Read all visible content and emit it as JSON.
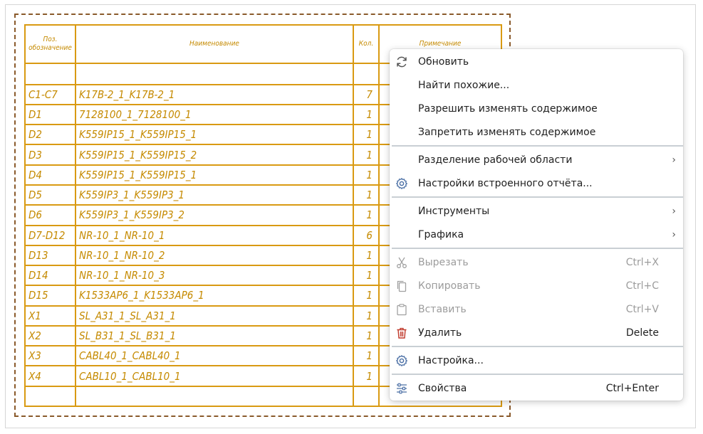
{
  "table": {
    "headers": {
      "pos_line1": "Поз.",
      "pos_line2": "обозначение",
      "name": "Наименование",
      "qty": "Кол.",
      "note": "Примечание"
    },
    "rows": [
      {
        "pos": "C1-C7",
        "name": "K17B-2_1_K17B-2_1",
        "qty": "7"
      },
      {
        "pos": "D1",
        "name": "7128100_1_7128100_1",
        "qty": "1"
      },
      {
        "pos": "D2",
        "name": "K559IP15_1_K559IP15_1",
        "qty": "1"
      },
      {
        "pos": "D3",
        "name": "K559IP15_1_K559IP15_2",
        "qty": "1"
      },
      {
        "pos": "D4",
        "name": "K559IP15_1_K559IP15_1",
        "qty": "1"
      },
      {
        "pos": "D5",
        "name": "K559IP3_1_K559IP3_1",
        "qty": "1"
      },
      {
        "pos": "D6",
        "name": "K559IP3_1_K559IP3_2",
        "qty": "1"
      },
      {
        "pos": "D7-D12",
        "name": "NR-10_1_NR-10_1",
        "qty": "6"
      },
      {
        "pos": "D13",
        "name": "NR-10_1_NR-10_2",
        "qty": "1"
      },
      {
        "pos": "D14",
        "name": "NR-10_1_NR-10_3",
        "qty": "1"
      },
      {
        "pos": "D15",
        "name": "K1533AP6_1_K1533AP6_1",
        "qty": "1"
      },
      {
        "pos": "X1",
        "name": "SL_A31_1_SL_A31_1",
        "qty": "1"
      },
      {
        "pos": "X2",
        "name": "SL_B31_1_SL_B31_1",
        "qty": "1"
      },
      {
        "pos": "X3",
        "name": "CABL40_1_CABL40_1",
        "qty": "1"
      },
      {
        "pos": "X4",
        "name": "CABL10_1_CABL10_1",
        "qty": "1"
      }
    ]
  },
  "menu": {
    "refresh": "Обновить",
    "find_similar": "Найти похожие...",
    "allow_edit": "Разрешить изменять содержимое",
    "deny_edit": "Запретить изменять содержимое",
    "split_workspace": "Разделение рабочей области",
    "report_settings": "Настройки встроенного отчёта...",
    "tools": "Инструменты",
    "graphics": "Графика",
    "cut": "Вырезать",
    "cut_shortcut": "Ctrl+X",
    "copy": "Копировать",
    "copy_shortcut": "Ctrl+C",
    "paste": "Вставить",
    "paste_shortcut": "Ctrl+V",
    "delete": "Удалить",
    "delete_shortcut": "Delete",
    "settings": "Настройка...",
    "properties": "Свойства",
    "properties_shortcut": "Ctrl+Enter"
  },
  "colors": {
    "table_line": "#d99a12",
    "table_text": "#c58a00",
    "frame_dash": "#8a5a2b",
    "icon_blue": "#4a6fa5",
    "delete_red": "#c0392b",
    "disabled": "#9c9c9c"
  }
}
